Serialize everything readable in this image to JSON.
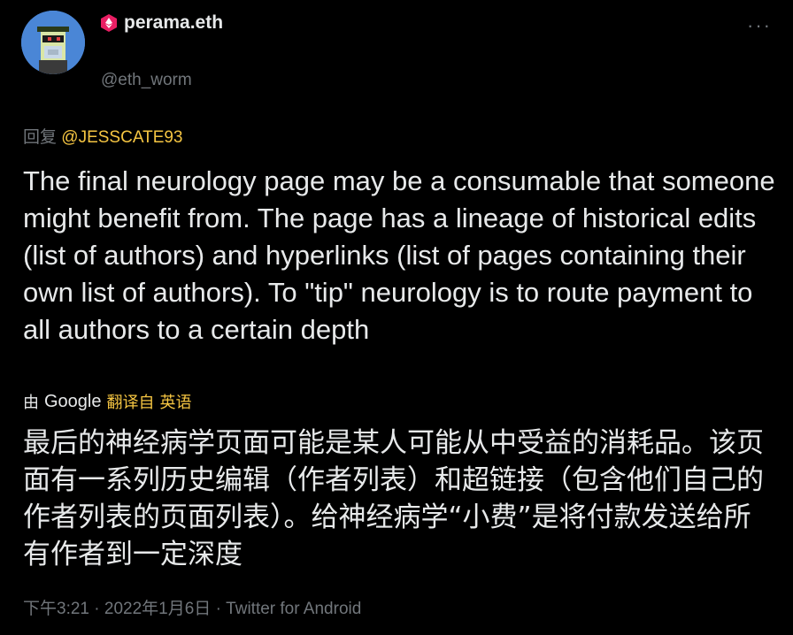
{
  "author": {
    "display_name": "perama.eth",
    "handle": "@eth_worm",
    "badge_icon": "ethereum-hexagon-icon",
    "avatar_icon": "pixel-punk-avatar"
  },
  "menu": {
    "more_label": "···"
  },
  "reply": {
    "prefix": "回复",
    "mention": "@JESSCATE93"
  },
  "tweet": {
    "text": "The final neurology page may be a consumable that someone might benefit from. The page has a lineage of historical edits (list of authors) and hyperlinks (list of pages containing their own list of authors). To \"tip\" neurology is to route payment to all authors to a certain depth"
  },
  "translation": {
    "by_label": "由",
    "provider": "Google",
    "translated_label": "翻译自",
    "source_language": "英语",
    "text": "最后的神经病学页面可能是某人可能从中受益的消耗品。该页面有一系列历史编辑（作者列表）和超链接（包含他们自己的作者列表的页面列表）。给神经病学“小费”是将付款发送给所有作者到一定深度"
  },
  "meta": {
    "time": "下午3:21",
    "date": "2022年1月6日",
    "client": "Twitter for Android",
    "separator": "·"
  },
  "colors": {
    "background": "#000000",
    "text": "#e7e9ea",
    "muted": "#71767b",
    "accent": "#f5c542"
  }
}
